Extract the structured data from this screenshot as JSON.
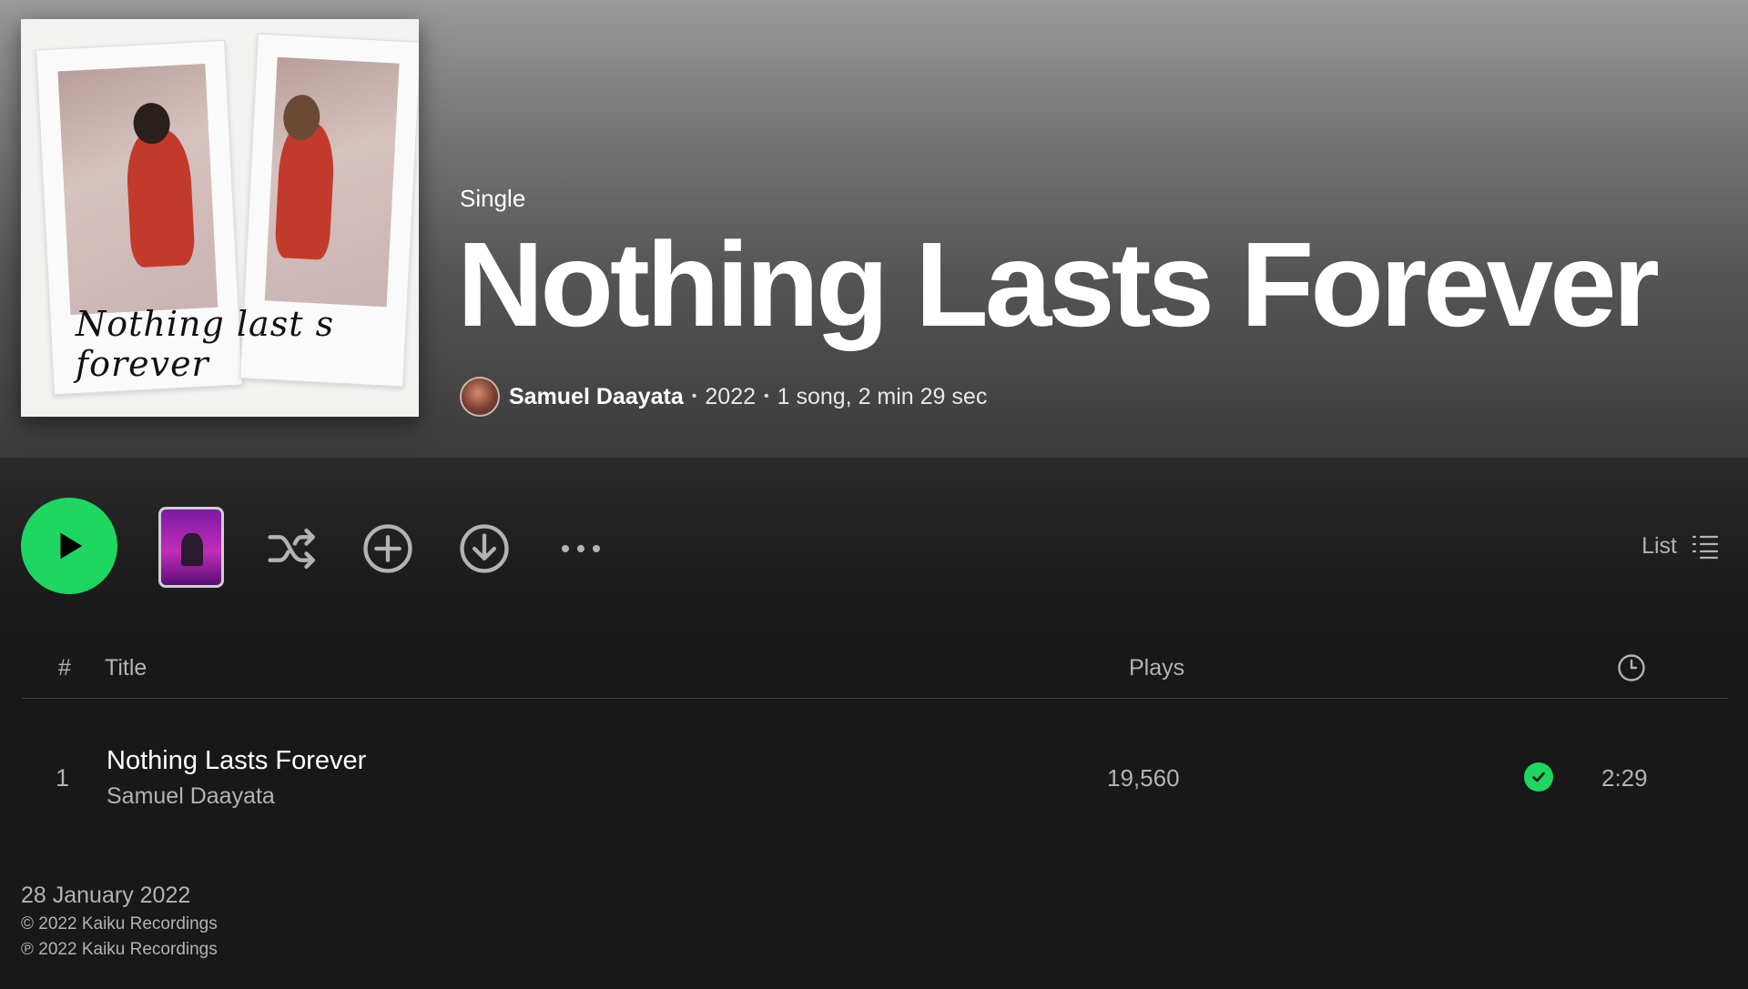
{
  "header": {
    "cover_text": "Nothing last  s forever",
    "type_label": "Single",
    "title": "Nothing Lasts Forever",
    "artist": "Samuel Daayata",
    "year": "2022",
    "summary": "1 song, 2 min 29 sec"
  },
  "actions": {
    "view_label": "List",
    "icons": [
      "play-icon",
      "shuffle-icon",
      "add-circle-icon",
      "download-icon",
      "more-icon",
      "list-icon"
    ]
  },
  "table": {
    "headers": {
      "num": "#",
      "title": "Title",
      "plays": "Plays",
      "duration_icon": "clock-icon"
    },
    "rows": [
      {
        "index": "1",
        "title": "Nothing Lasts Forever",
        "artist": "Samuel Daayata",
        "plays": "19,560",
        "duration": "2:29",
        "saved": true
      }
    ]
  },
  "footer": {
    "release_date": "28 January 2022",
    "copyright": "© 2022 Kaiku Recordings",
    "phonogram": "℗ 2022 Kaiku Recordings"
  },
  "colors": {
    "accent": "#1ed760",
    "background": "#181818",
    "muted_text": "#b3b3b3"
  }
}
